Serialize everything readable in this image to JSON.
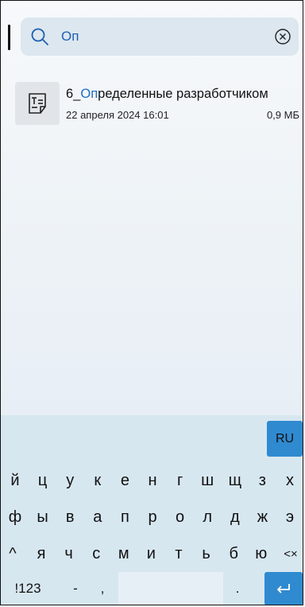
{
  "search": {
    "query": "Оп",
    "icon": "search-icon",
    "clear_icon": "clear-icon"
  },
  "results": [
    {
      "name_highlight_prefix": "6_",
      "name_highlight": "Оп",
      "name_rest": "ределенные разработчиком",
      "date": "22 апреля 2024 16:01",
      "size": "0,9 МБ",
      "icon": "text-document-icon"
    }
  ],
  "keyboard": {
    "language": "RU",
    "row1": [
      "й",
      "ц",
      "у",
      "к",
      "е",
      "н",
      "г",
      "ш",
      "щ",
      "з",
      "х"
    ],
    "row2": [
      "ф",
      "ы",
      "в",
      "а",
      "п",
      "р",
      "о",
      "л",
      "д",
      "ж",
      "э"
    ],
    "row3": [
      "я",
      "ч",
      "с",
      "м",
      "и",
      "т",
      "ь",
      "б",
      "ю"
    ],
    "shift_label": "^",
    "backspace_label": "<×",
    "numbers_label": "!123",
    "dash_label": "-",
    "comma_label": ",",
    "period_label": "."
  },
  "colors": {
    "accent": "#2f8ad0",
    "highlight": "#1f6fc0",
    "search_bg": "#dce7ef",
    "keyboard_bg": "#d7e7f0"
  }
}
